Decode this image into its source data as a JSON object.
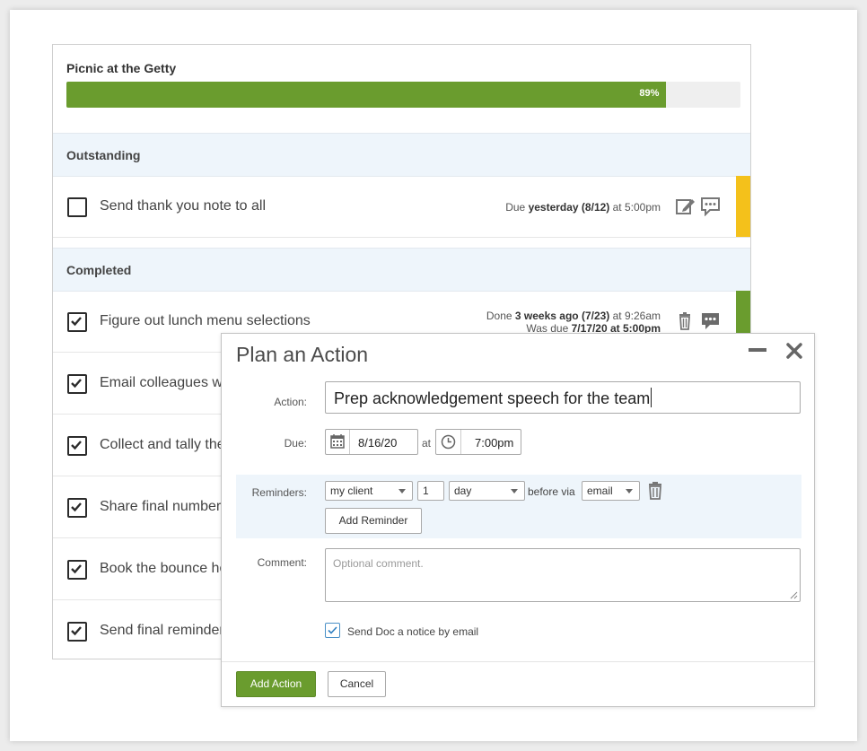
{
  "task_card": {
    "title": "Picnic at the Getty",
    "progress": {
      "percent": 89,
      "label": "89%"
    },
    "outstanding_heading": "Outstanding",
    "completed_heading": "Completed",
    "outstanding_items": [
      {
        "label": "Send thank you note to all",
        "due_prefix": "Due ",
        "due_bold": "yesterday (8/12)",
        "due_suffix": " at 5:00pm",
        "stripe_color": "#f4c11b"
      }
    ],
    "completed_items": [
      {
        "label": "Figure out lunch menu selections",
        "done_prefix": "Done ",
        "done_bold": "3 weeks ago (7/23)",
        "done_suffix": " at 9:26am",
        "wasdue_prefix": "Was due ",
        "wasdue_bold": "7/17/20 at 5:00pm",
        "stripe_color": "#6a9c2e"
      },
      {
        "label": "Email colleagues w"
      },
      {
        "label": "Collect and tally the"
      },
      {
        "label": "Share final numbers"
      },
      {
        "label": "Book the bounce ho"
      },
      {
        "label": "Send final reminder"
      }
    ]
  },
  "dialog": {
    "title": "Plan an Action",
    "action_label": "Action:",
    "action_value": "Prep acknowledgement speech for the team",
    "due_label": "Due:",
    "due_date": "8/16/20",
    "at_label": "at",
    "due_time": "7:00pm",
    "reminders_label": "Reminders:",
    "reminder": {
      "recipient": "my client",
      "amount": "1",
      "unit": "day",
      "before_via": "before via",
      "channel": "email"
    },
    "add_reminder_label": "Add Reminder",
    "comment_label": "Comment:",
    "comment_placeholder": "Optional comment.",
    "notify_label": "Send Doc a notice by email",
    "notify_checked": true,
    "add_action_label": "Add Action",
    "cancel_label": "Cancel"
  },
  "colors": {
    "accent_green": "#6a9c2e",
    "warning_yellow": "#f4c11b",
    "section_bg": "#eef5fb"
  }
}
